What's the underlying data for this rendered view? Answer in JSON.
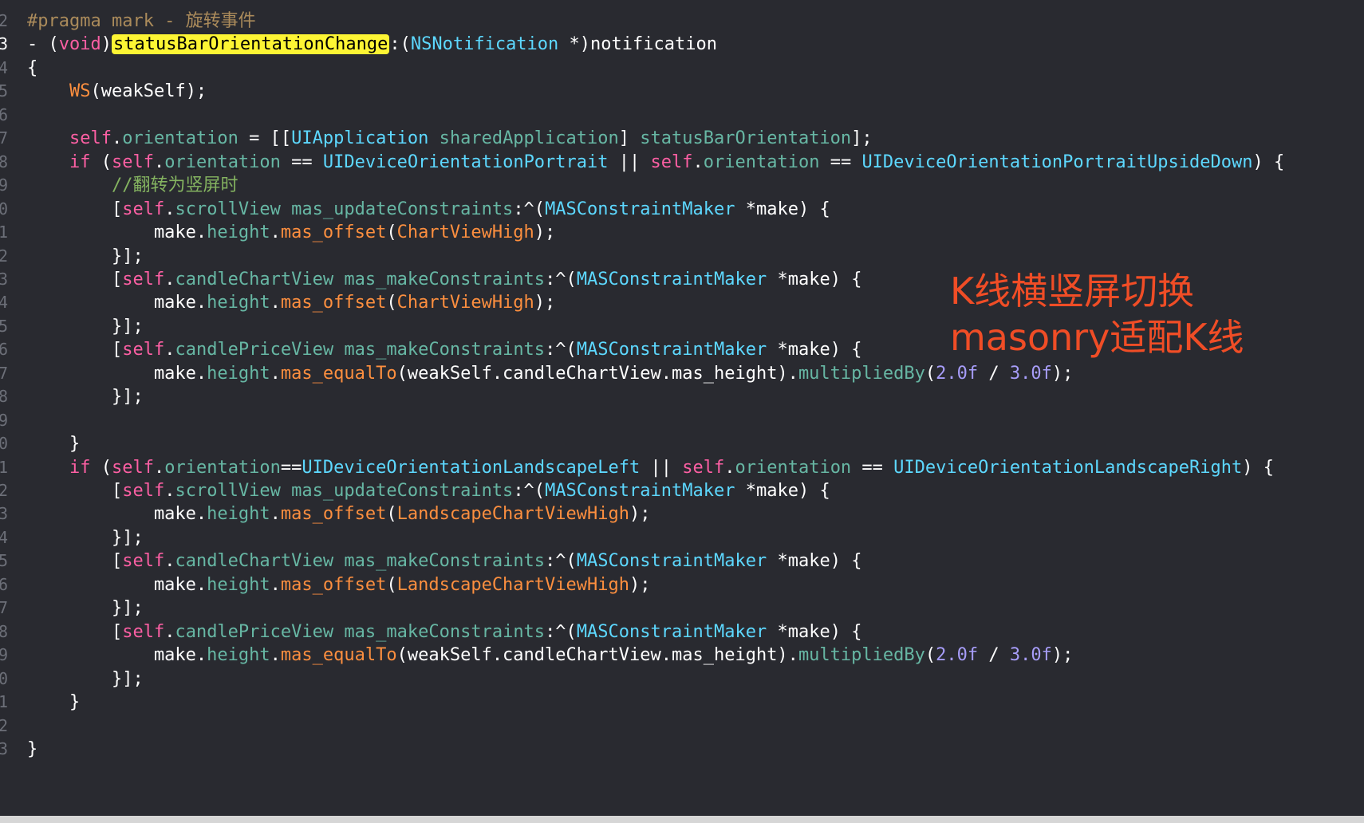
{
  "editor": {
    "lines": [
      {
        "gutter": "2",
        "current": false,
        "tokens": [
          {
            "t": "#pragma mark - 旋转事件",
            "c": "mark"
          }
        ]
      },
      {
        "gutter": "3",
        "current": true,
        "tokens": [
          {
            "t": "- (",
            "c": "plain"
          },
          {
            "t": "void",
            "c": "kw"
          },
          {
            "t": ")",
            "c": "plain"
          },
          {
            "t": "statusBarOrientationChange",
            "c": "hl"
          },
          {
            "t": ":(",
            "c": "plain"
          },
          {
            "t": "NSNotification",
            "c": "type"
          },
          {
            "t": " *)notification",
            "c": "plain"
          }
        ]
      },
      {
        "gutter": "4",
        "current": false,
        "tokens": [
          {
            "t": "{",
            "c": "plain"
          }
        ]
      },
      {
        "gutter": "5",
        "current": false,
        "tokens": [
          {
            "t": "    ",
            "c": "plain"
          },
          {
            "t": "WS",
            "c": "macro"
          },
          {
            "t": "(weakSelf);",
            "c": "plain"
          }
        ]
      },
      {
        "gutter": "6",
        "current": false,
        "tokens": []
      },
      {
        "gutter": "7",
        "current": false,
        "tokens": [
          {
            "t": "    ",
            "c": "plain"
          },
          {
            "t": "self",
            "c": "self"
          },
          {
            "t": ".",
            "c": "plain"
          },
          {
            "t": "orientation",
            "c": "prop"
          },
          {
            "t": " = [[",
            "c": "plain"
          },
          {
            "t": "UIApplication",
            "c": "type"
          },
          {
            "t": " ",
            "c": "plain"
          },
          {
            "t": "sharedApplication",
            "c": "method"
          },
          {
            "t": "] ",
            "c": "plain"
          },
          {
            "t": "statusBarOrientation",
            "c": "method"
          },
          {
            "t": "];",
            "c": "plain"
          }
        ]
      },
      {
        "gutter": "8",
        "current": false,
        "tokens": [
          {
            "t": "    ",
            "c": "plain"
          },
          {
            "t": "if",
            "c": "kw"
          },
          {
            "t": " (",
            "c": "plain"
          },
          {
            "t": "self",
            "c": "self"
          },
          {
            "t": ".",
            "c": "plain"
          },
          {
            "t": "orientation",
            "c": "prop"
          },
          {
            "t": " == ",
            "c": "plain"
          },
          {
            "t": "UIDeviceOrientationPortrait",
            "c": "type"
          },
          {
            "t": " || ",
            "c": "plain"
          },
          {
            "t": "self",
            "c": "self"
          },
          {
            "t": ".",
            "c": "plain"
          },
          {
            "t": "orientation",
            "c": "prop"
          },
          {
            "t": " == ",
            "c": "plain"
          },
          {
            "t": "UIDeviceOrientationPortraitUpsideDown",
            "c": "type"
          },
          {
            "t": ") {",
            "c": "plain"
          }
        ]
      },
      {
        "gutter": "9",
        "current": false,
        "tokens": [
          {
            "t": "        ",
            "c": "plain"
          },
          {
            "t": "//翻转为竖屏时",
            "c": "comment"
          }
        ]
      },
      {
        "gutter": "0",
        "current": false,
        "tokens": [
          {
            "t": "        [",
            "c": "plain"
          },
          {
            "t": "self",
            "c": "self"
          },
          {
            "t": ".",
            "c": "plain"
          },
          {
            "t": "scrollView",
            "c": "prop"
          },
          {
            "t": " ",
            "c": "plain"
          },
          {
            "t": "mas_updateConstraints",
            "c": "method"
          },
          {
            "t": ":^(",
            "c": "plain"
          },
          {
            "t": "MASConstraintMaker",
            "c": "type"
          },
          {
            "t": " *make) {",
            "c": "plain"
          }
        ]
      },
      {
        "gutter": "1",
        "current": false,
        "tokens": [
          {
            "t": "            make.",
            "c": "plain"
          },
          {
            "t": "height",
            "c": "prop"
          },
          {
            "t": ".",
            "c": "plain"
          },
          {
            "t": "mas_offset",
            "c": "macro"
          },
          {
            "t": "(",
            "c": "plain"
          },
          {
            "t": "ChartViewHigh",
            "c": "macro"
          },
          {
            "t": ");",
            "c": "plain"
          }
        ]
      },
      {
        "gutter": "2",
        "current": false,
        "tokens": [
          {
            "t": "        }];",
            "c": "plain"
          }
        ]
      },
      {
        "gutter": "3",
        "current": false,
        "tokens": [
          {
            "t": "        [",
            "c": "plain"
          },
          {
            "t": "self",
            "c": "self"
          },
          {
            "t": ".",
            "c": "plain"
          },
          {
            "t": "candleChartView",
            "c": "prop"
          },
          {
            "t": " ",
            "c": "plain"
          },
          {
            "t": "mas_makeConstraints",
            "c": "method"
          },
          {
            "t": ":^(",
            "c": "plain"
          },
          {
            "t": "MASConstraintMaker",
            "c": "type"
          },
          {
            "t": " *make) {",
            "c": "plain"
          }
        ]
      },
      {
        "gutter": "4",
        "current": false,
        "tokens": [
          {
            "t": "            make.",
            "c": "plain"
          },
          {
            "t": "height",
            "c": "prop"
          },
          {
            "t": ".",
            "c": "plain"
          },
          {
            "t": "mas_offset",
            "c": "macro"
          },
          {
            "t": "(",
            "c": "plain"
          },
          {
            "t": "ChartViewHigh",
            "c": "macro"
          },
          {
            "t": ");",
            "c": "plain"
          }
        ]
      },
      {
        "gutter": "5",
        "current": false,
        "tokens": [
          {
            "t": "        }];",
            "c": "plain"
          }
        ]
      },
      {
        "gutter": "6",
        "current": false,
        "tokens": [
          {
            "t": "        [",
            "c": "plain"
          },
          {
            "t": "self",
            "c": "self"
          },
          {
            "t": ".",
            "c": "plain"
          },
          {
            "t": "candlePriceView",
            "c": "prop"
          },
          {
            "t": " ",
            "c": "plain"
          },
          {
            "t": "mas_makeConstraints",
            "c": "method"
          },
          {
            "t": ":^(",
            "c": "plain"
          },
          {
            "t": "MASConstraintMaker",
            "c": "type"
          },
          {
            "t": " *make) {",
            "c": "plain"
          }
        ]
      },
      {
        "gutter": "7",
        "current": false,
        "tokens": [
          {
            "t": "            make.",
            "c": "plain"
          },
          {
            "t": "height",
            "c": "prop"
          },
          {
            "t": ".",
            "c": "plain"
          },
          {
            "t": "mas_equalTo",
            "c": "macro"
          },
          {
            "t": "(weakSelf.candleChartView.mas_height).",
            "c": "plain"
          },
          {
            "t": "multipliedBy",
            "c": "method"
          },
          {
            "t": "(",
            "c": "plain"
          },
          {
            "t": "2.0f",
            "c": "num"
          },
          {
            "t": " / ",
            "c": "plain"
          },
          {
            "t": "3.0f",
            "c": "num"
          },
          {
            "t": ");",
            "c": "plain"
          }
        ]
      },
      {
        "gutter": "8",
        "current": false,
        "tokens": [
          {
            "t": "        }];",
            "c": "plain"
          }
        ]
      },
      {
        "gutter": "9",
        "current": false,
        "tokens": []
      },
      {
        "gutter": "0",
        "current": false,
        "tokens": [
          {
            "t": "    }",
            "c": "plain"
          }
        ]
      },
      {
        "gutter": "1",
        "current": false,
        "tokens": [
          {
            "t": "    ",
            "c": "plain"
          },
          {
            "t": "if",
            "c": "kw"
          },
          {
            "t": " (",
            "c": "plain"
          },
          {
            "t": "self",
            "c": "self"
          },
          {
            "t": ".",
            "c": "plain"
          },
          {
            "t": "orientation",
            "c": "prop"
          },
          {
            "t": "==",
            "c": "plain"
          },
          {
            "t": "UIDeviceOrientationLandscapeLeft",
            "c": "type"
          },
          {
            "t": " || ",
            "c": "plain"
          },
          {
            "t": "self",
            "c": "self"
          },
          {
            "t": ".",
            "c": "plain"
          },
          {
            "t": "orientation",
            "c": "prop"
          },
          {
            "t": " == ",
            "c": "plain"
          },
          {
            "t": "UIDeviceOrientationLandscapeRight",
            "c": "type"
          },
          {
            "t": ") {",
            "c": "plain"
          }
        ]
      },
      {
        "gutter": "2",
        "current": false,
        "tokens": [
          {
            "t": "        [",
            "c": "plain"
          },
          {
            "t": "self",
            "c": "self"
          },
          {
            "t": ".",
            "c": "plain"
          },
          {
            "t": "scrollView",
            "c": "prop"
          },
          {
            "t": " ",
            "c": "plain"
          },
          {
            "t": "mas_updateConstraints",
            "c": "method"
          },
          {
            "t": ":^(",
            "c": "plain"
          },
          {
            "t": "MASConstraintMaker",
            "c": "type"
          },
          {
            "t": " *make) {",
            "c": "plain"
          }
        ]
      },
      {
        "gutter": "3",
        "current": false,
        "tokens": [
          {
            "t": "            make.",
            "c": "plain"
          },
          {
            "t": "height",
            "c": "prop"
          },
          {
            "t": ".",
            "c": "plain"
          },
          {
            "t": "mas_offset",
            "c": "macro"
          },
          {
            "t": "(",
            "c": "plain"
          },
          {
            "t": "LandscapeChartViewHigh",
            "c": "macro"
          },
          {
            "t": ");",
            "c": "plain"
          }
        ]
      },
      {
        "gutter": "4",
        "current": false,
        "tokens": [
          {
            "t": "        }];",
            "c": "plain"
          }
        ]
      },
      {
        "gutter": "5",
        "current": false,
        "tokens": [
          {
            "t": "        [",
            "c": "plain"
          },
          {
            "t": "self",
            "c": "self"
          },
          {
            "t": ".",
            "c": "plain"
          },
          {
            "t": "candleChartView",
            "c": "prop"
          },
          {
            "t": " ",
            "c": "plain"
          },
          {
            "t": "mas_makeConstraints",
            "c": "method"
          },
          {
            "t": ":^(",
            "c": "plain"
          },
          {
            "t": "MASConstraintMaker",
            "c": "type"
          },
          {
            "t": " *make) {",
            "c": "plain"
          }
        ]
      },
      {
        "gutter": "6",
        "current": false,
        "tokens": [
          {
            "t": "            make.",
            "c": "plain"
          },
          {
            "t": "height",
            "c": "prop"
          },
          {
            "t": ".",
            "c": "plain"
          },
          {
            "t": "mas_offset",
            "c": "macro"
          },
          {
            "t": "(",
            "c": "plain"
          },
          {
            "t": "LandscapeChartViewHigh",
            "c": "macro"
          },
          {
            "t": ");",
            "c": "plain"
          }
        ]
      },
      {
        "gutter": "7",
        "current": false,
        "tokens": [
          {
            "t": "        }];",
            "c": "plain"
          }
        ]
      },
      {
        "gutter": "8",
        "current": false,
        "tokens": [
          {
            "t": "        [",
            "c": "plain"
          },
          {
            "t": "self",
            "c": "self"
          },
          {
            "t": ".",
            "c": "plain"
          },
          {
            "t": "candlePriceView",
            "c": "prop"
          },
          {
            "t": " ",
            "c": "plain"
          },
          {
            "t": "mas_makeConstraints",
            "c": "method"
          },
          {
            "t": ":^(",
            "c": "plain"
          },
          {
            "t": "MASConstraintMaker",
            "c": "type"
          },
          {
            "t": " *make) {",
            "c": "plain"
          }
        ]
      },
      {
        "gutter": "9",
        "current": false,
        "tokens": [
          {
            "t": "            make.",
            "c": "plain"
          },
          {
            "t": "height",
            "c": "prop"
          },
          {
            "t": ".",
            "c": "plain"
          },
          {
            "t": "mas_equalTo",
            "c": "macro"
          },
          {
            "t": "(weakSelf.candleChartView.mas_height).",
            "c": "plain"
          },
          {
            "t": "multipliedBy",
            "c": "method"
          },
          {
            "t": "(",
            "c": "plain"
          },
          {
            "t": "2.0f",
            "c": "num"
          },
          {
            "t": " / ",
            "c": "plain"
          },
          {
            "t": "3.0f",
            "c": "num"
          },
          {
            "t": ");",
            "c": "plain"
          }
        ]
      },
      {
        "gutter": "0",
        "current": false,
        "tokens": [
          {
            "t": "        }];",
            "c": "plain"
          }
        ]
      },
      {
        "gutter": "1",
        "current": false,
        "tokens": [
          {
            "t": "    }",
            "c": "plain"
          }
        ]
      },
      {
        "gutter": "2",
        "current": false,
        "tokens": []
      },
      {
        "gutter": "3",
        "current": false,
        "tokens": [
          {
            "t": "}",
            "c": "plain"
          }
        ]
      }
    ]
  },
  "annotation": {
    "line1": "K线横竖屏切换",
    "line2": "masonry适配K线",
    "color": "#f04d26"
  },
  "theme": {
    "background": "#292a30",
    "keyword": "#fc5fa3",
    "property": "#67b7a4",
    "type": "#5dd8ff",
    "macro": "#fd8f3f",
    "number": "#a79df9",
    "comment": "#84b360",
    "highlight": "#fdf534"
  }
}
